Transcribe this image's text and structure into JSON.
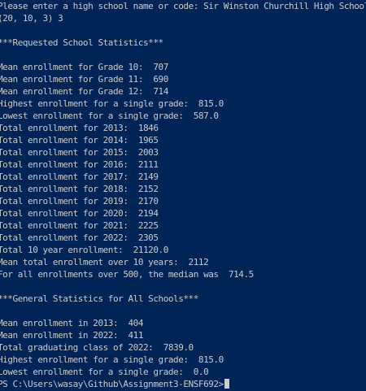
{
  "terminal": {
    "background": "#012456",
    "foreground": "#cccccc",
    "lines": [
      "Please enter a high school name or code: Sir Winston Churchill High School",
      "(20, 10, 3) 3",
      "",
      "***Requested School Statistics***",
      "",
      "Mean enrollment for Grade 10:  707",
      "Mean enrollment for Grade 11:  690",
      "Mean enrollment for Grade 12:  714",
      "Highest enrollment for a single grade:  815.0",
      "Lowest enrollment for a single grade:  587.0",
      "Total enrollment for 2013:  1846",
      "Total enrollment for 2014:  1965",
      "Total enrollment for 2015:  2003",
      "Total enrollment for 2016:  2111",
      "Total enrollment for 2017:  2149",
      "Total enrollment for 2018:  2152",
      "Total enrollment for 2019:  2170",
      "Total enrollment for 2020:  2194",
      "Total enrollment for 2021:  2225",
      "Total enrollment for 2022:  2305",
      "Total 10 year enrollment:  21120.0",
      "Mean total enrollment over 10 years:  2112",
      "For all enrollments over 500, the median was  714.5",
      "",
      "***General Statistics for All Schools***",
      "",
      "Mean enrollment in 2013:  404",
      "Mean enrollment in 2022:  411",
      "Total graduating class of 2022:  7839.0",
      "Highest enrollment for a single grade:  815.0",
      "Lowest enrollment for a single grade:  0.0"
    ],
    "prompt": "PS C:\\Users\\wasay\\Github\\Assignment3-ENSF692>"
  }
}
